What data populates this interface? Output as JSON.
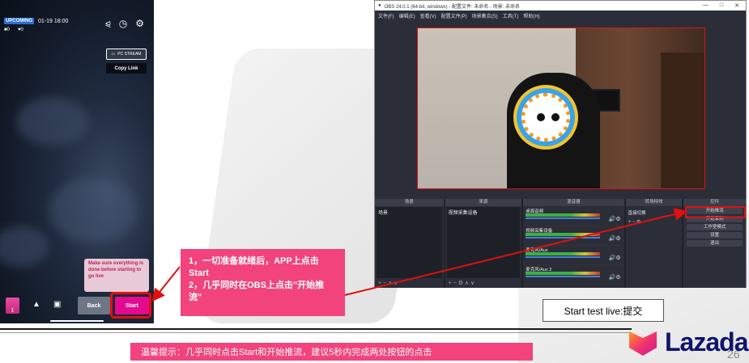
{
  "phone": {
    "badge": "UPCOMING",
    "datetime": "01-19 18:00",
    "viewers": "0",
    "likes": "0",
    "pc_stream": "PC STREAM",
    "copy_link": "Copy Link",
    "tip": "Make sure everything is done before starting to go live",
    "gift_count": "1",
    "back": "Back",
    "start": "Start"
  },
  "callout": {
    "line1": "1，一切准备就绪后，APP上点击Start",
    "line2": "2，几乎同时在OBS上点击\"开始推流\""
  },
  "obs": {
    "title": "OBS 24.0.1 (64-bit, windows) - 配置文件: 未命名 - 场景: 未命名",
    "menu": [
      "文件(F)",
      "编辑(E)",
      "查看(V)",
      "配置文件(P)",
      "场景集合(S)",
      "工具(T)",
      "帮助(H)"
    ],
    "docks": {
      "scenes": {
        "title": "场景",
        "items": [
          "场景"
        ]
      },
      "sources": {
        "title": "来源",
        "items": [
          "视频采集设备"
        ]
      },
      "mixer": {
        "title": "混音器",
        "channels": [
          "桌面音频",
          "视频采集设备",
          "麦克风/Aux",
          "麦克风/Aux 2"
        ]
      },
      "transitions": {
        "title": "转场特效",
        "value": "直接切换"
      },
      "controls": {
        "title": "控件",
        "buttons": [
          "开始推流",
          "开始录制",
          "工作室模式",
          "设置",
          "退出"
        ]
      }
    }
  },
  "caption": "Start test live:提交",
  "notice": "温馨提示：几乎同时点击Start和开始推流，建议5秒内完成两处按钮的点击",
  "logo": {
    "text": "Lazada",
    "color": "#0f146d"
  },
  "page_number": "26",
  "colors": {
    "accent_pink": "#f2437c",
    "start_pink": "#e40a8f",
    "highlight_red": "#e01010"
  }
}
